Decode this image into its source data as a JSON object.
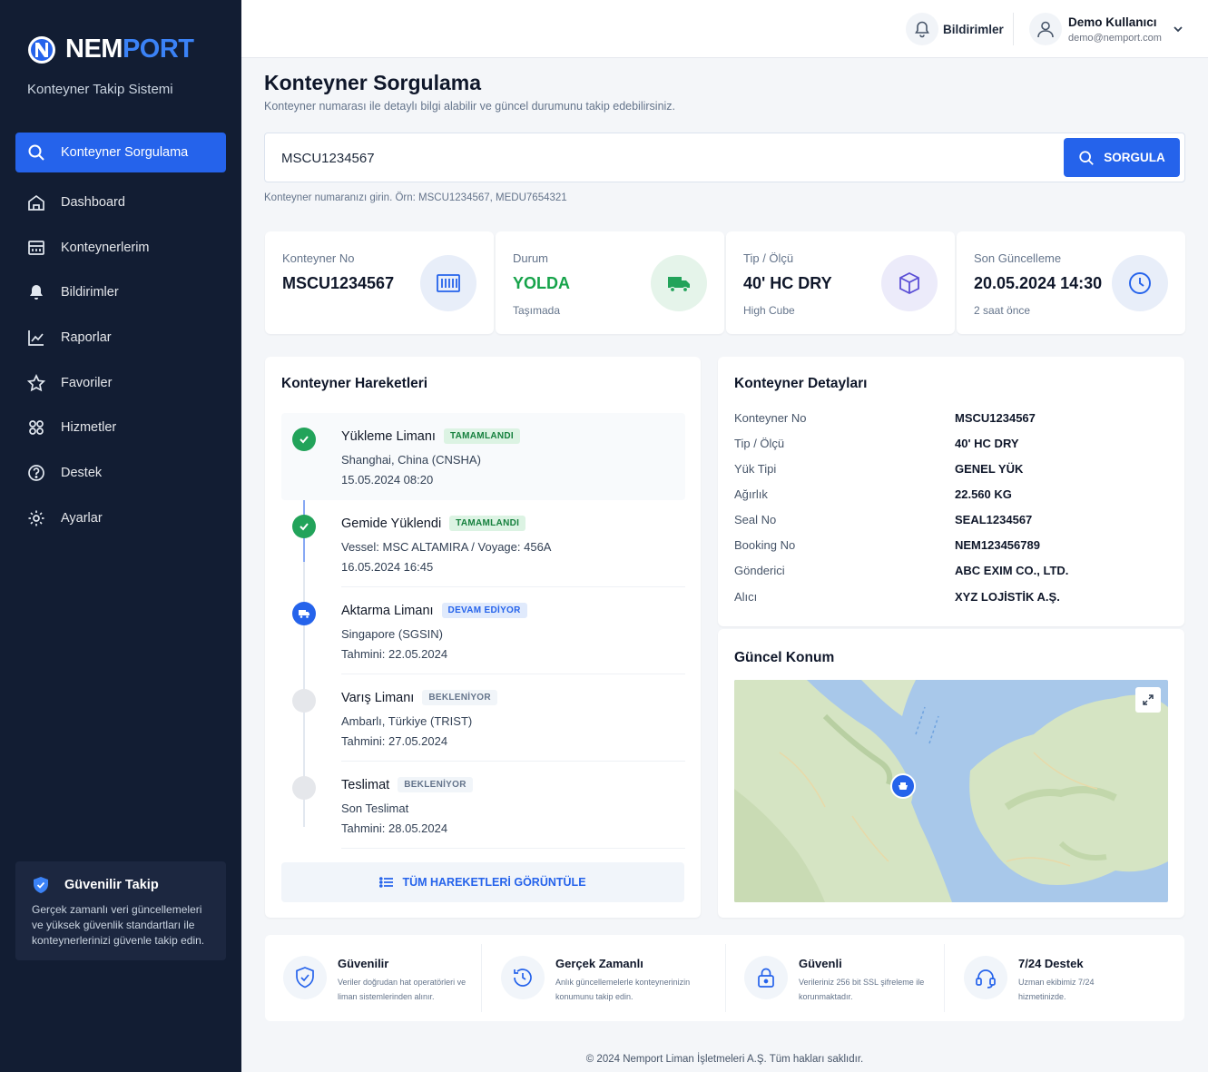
{
  "brand": {
    "name_part1": "NEM",
    "name_part2": "PORT",
    "subtitle": "Konteyner Takip Sistemi"
  },
  "sidebar": {
    "items": [
      {
        "label": "Konteyner Sorgulama",
        "icon": "search-icon",
        "active": true
      },
      {
        "label": "Dashboard",
        "icon": "home-icon"
      },
      {
        "label": "Konteynerlerim",
        "icon": "container-icon"
      },
      {
        "label": "Bildirimler",
        "icon": "bell-icon"
      },
      {
        "label": "Raporlar",
        "icon": "chart-icon"
      },
      {
        "label": "Favoriler",
        "icon": "star-icon"
      },
      {
        "label": "Hizmetler",
        "icon": "services-icon"
      },
      {
        "label": "Destek",
        "icon": "help-icon"
      },
      {
        "label": "Ayarlar",
        "icon": "gear-icon"
      }
    ],
    "trust": {
      "title": "Güvenilir Takip",
      "text": "Gerçek zamanlı veri güncellemeleri ve yüksek güvenlik standartları ile konteynerlerinizi güvenle takip edin."
    }
  },
  "topbar": {
    "notifications_label": "Bildirimler",
    "user_name": "Demo Kullanıcı",
    "user_email": "demo@nemport.com"
  },
  "page": {
    "title": "Konteyner Sorgulama",
    "subtitle": "Konteyner numarası ile detaylı bilgi alabilir ve güncel durumunu takip edebilirsiniz."
  },
  "search": {
    "value": "MSCU1234567",
    "button": "SORGULA",
    "hint": "Konteyner numaranızı girin. Örn: MSCU1234567, MEDU7654321"
  },
  "stats": [
    {
      "label": "Konteyner No",
      "value": "MSCU1234567",
      "sub": "",
      "color": "#0f172a",
      "icon": "container-icon"
    },
    {
      "label": "Durum",
      "value": "YOLDA",
      "sub": "Taşımada",
      "color": "#16a34a",
      "icon": "truck-icon"
    },
    {
      "label": "Tip / Ölçü",
      "value": "40' HC DRY",
      "sub": "High Cube",
      "color": "#0f172a",
      "icon": "box-icon"
    },
    {
      "label": "Son Güncelleme",
      "value": "20.05.2024 14:30",
      "sub": "2 saat önce",
      "color": "#0f172a",
      "icon": "clock-icon"
    }
  ],
  "movements": {
    "title": "Konteyner Hareketleri",
    "items": [
      {
        "title": "Yükleme Limanı",
        "badge": "TAMAMLANDI",
        "status": "done",
        "line1": "Shanghai, China (CNSHA)",
        "line2": "15.05.2024 08:20"
      },
      {
        "title": "Gemide Yüklendi",
        "badge": "TAMAMLANDI",
        "status": "done",
        "line1": "Vessel: MSC ALTAMIRA / Voyage: 456A",
        "line2": "16.05.2024 16:45"
      },
      {
        "title": "Aktarma Limanı",
        "badge": "DEVAM EDİYOR",
        "status": "active",
        "line1": "Singapore (SGSIN)",
        "line2": "Tahmini: 22.05.2024"
      },
      {
        "title": "Varış Limanı",
        "badge": "BEKLENİYOR",
        "status": "pending",
        "line1": "Ambarlı, Türkiye (TRIST)",
        "line2": "Tahmini: 27.05.2024"
      },
      {
        "title": "Teslimat",
        "badge": "BEKLENİYOR",
        "status": "pending",
        "line1": "Son Teslimat",
        "line2": "Tahmini: 28.05.2024"
      }
    ],
    "all_button": "TÜM HAREKETLERİ GÖRÜNTÜLE"
  },
  "details": {
    "title": "Konteyner Detayları",
    "rows": [
      {
        "key": "Konteyner No",
        "value": "MSCU1234567"
      },
      {
        "key": "Tip / Ölçü",
        "value": "40' HC DRY"
      },
      {
        "key": "Yük Tipi",
        "value": "GENEL YÜK"
      },
      {
        "key": "Ağırlık",
        "value": "22.560 KG"
      },
      {
        "key": "Seal No",
        "value": "SEAL1234567"
      },
      {
        "key": "Booking No",
        "value": "NEM123456789"
      },
      {
        "key": "Gönderici",
        "value": "ABC EXIM CO., LTD."
      },
      {
        "key": "Alıcı",
        "value": "XYZ LOJİSTİK A.Ş."
      }
    ]
  },
  "location": {
    "title": "Güncel Konum"
  },
  "features": [
    {
      "title": "Güvenilir",
      "text": "Veriler doğrudan hat operatörleri ve liman sistemlerinden alınır.",
      "icon": "shield-icon"
    },
    {
      "title": "Gerçek Zamanlı",
      "text": "Anlık güncellemelerle konteynerinizin konumunu takip edin.",
      "icon": "history-icon"
    },
    {
      "title": "Güvenli",
      "text": "Verileriniz 256 bit SSL şifreleme ile korunmaktadır.",
      "icon": "lock-icon"
    },
    {
      "title": "7/24 Destek",
      "text": "Uzman ekibimiz 7/24 hizmetinizde.",
      "icon": "headset-icon"
    }
  ],
  "footer": "© 2024 Nemport Liman İşletmeleri A.Ş. Tüm hakları saklıdır.",
  "colors": {
    "primary": "#2563eb",
    "sidebar": "#121d33",
    "success": "#16a34a"
  }
}
